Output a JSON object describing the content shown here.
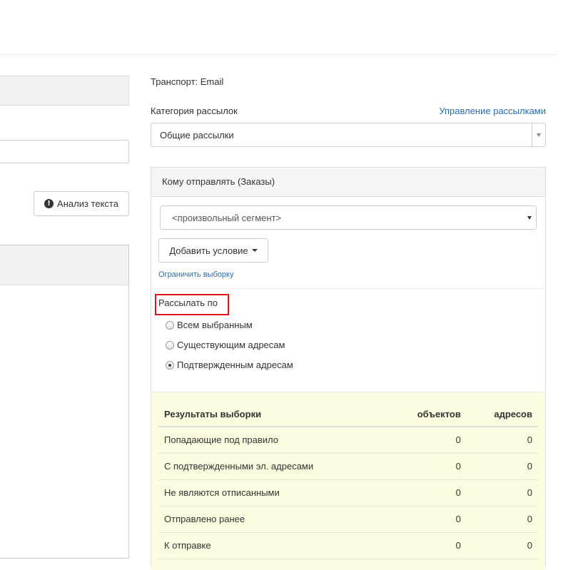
{
  "left": {
    "analyze_icon": "info-circle-icon",
    "analyze_label": "Анализ текста"
  },
  "transport": "Транспорт: Email",
  "category": {
    "label": "Категория рассылок",
    "manage_link": "Управление рассылками",
    "selected": "Общие рассылки"
  },
  "recipients": {
    "title": "Кому отправлять (Заказы)",
    "segment_selected": "<произвольный сегмент>",
    "add_condition": "Добавить условие",
    "limit_link": "Ограничить выборку",
    "send_by_label": "Рассылать по",
    "options": [
      {
        "label": "Всем выбранным",
        "checked": false
      },
      {
        "label": "Существующим адресам",
        "checked": false
      },
      {
        "label": "Подтвержденным адресам",
        "checked": true
      }
    ]
  },
  "results": {
    "headers": [
      "Результаты выборки",
      "объектов",
      "адресов"
    ],
    "rows": [
      [
        "Попадающие под правило",
        "0",
        "0"
      ],
      [
        "С подтвержденными эл. адресами",
        "0",
        "0"
      ],
      [
        "Не являются отписанными",
        "0",
        "0"
      ],
      [
        "Отправлено ранее",
        "0",
        "0"
      ],
      [
        "К отправке",
        "0",
        "0"
      ]
    ]
  },
  "colors": {
    "link": "#2a6db0",
    "highlight_border": "#e0141c",
    "results_bg": "#fcfce0"
  }
}
